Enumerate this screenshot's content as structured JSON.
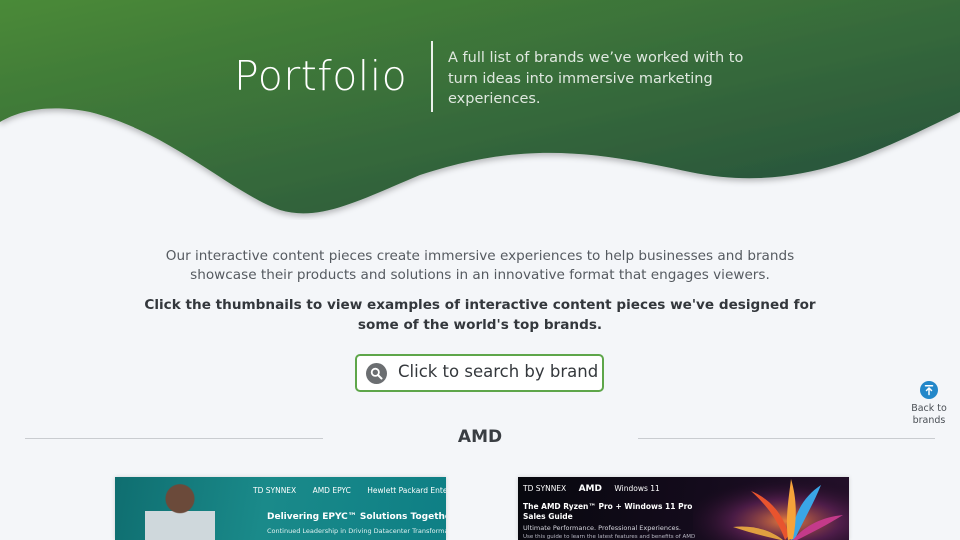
{
  "hero": {
    "title": "Portfolio",
    "subtitle": "A full list of brands we’ve worked with to turn ideas into immersive marketing experiences.",
    "gradient_start": "#4a8a38",
    "gradient_end": "#244d3c"
  },
  "intro": {
    "text": "Our interactive content pieces create immersive experiences to help businesses and brands showcase their products and solutions in an innovative format that engages viewers.",
    "cta": "Click the thumbnails to view examples of interactive content pieces we've designed for some of the world's top brands."
  },
  "search": {
    "label": "Click to search by brand",
    "icon": "search-icon",
    "border_color": "#5ea64a"
  },
  "back_to_top": {
    "label": "Back to brands",
    "icon": "arrow-up-to-top-icon",
    "color": "#2387c9"
  },
  "section": {
    "heading": "AMD"
  },
  "thumbnails": [
    {
      "brands": [
        "TD SYNNEX",
        "AMD EPYC",
        "Hewlett Packard Enterprise"
      ],
      "headline": "Delivering EPYC™ Solutions Together",
      "subline": "Continued Leadership in Driving Datacenter Transformation"
    },
    {
      "brands": [
        "TD SYNNEX",
        "AMD",
        "Windows 11"
      ],
      "headline": "The AMD Ryzen™ Pro + Windows 11 Pro Sales Guide",
      "subline": "Ultimate Performance. Professional Experiences.",
      "subline2": "Use this guide to learn the latest features and benefits of AMD"
    }
  ]
}
